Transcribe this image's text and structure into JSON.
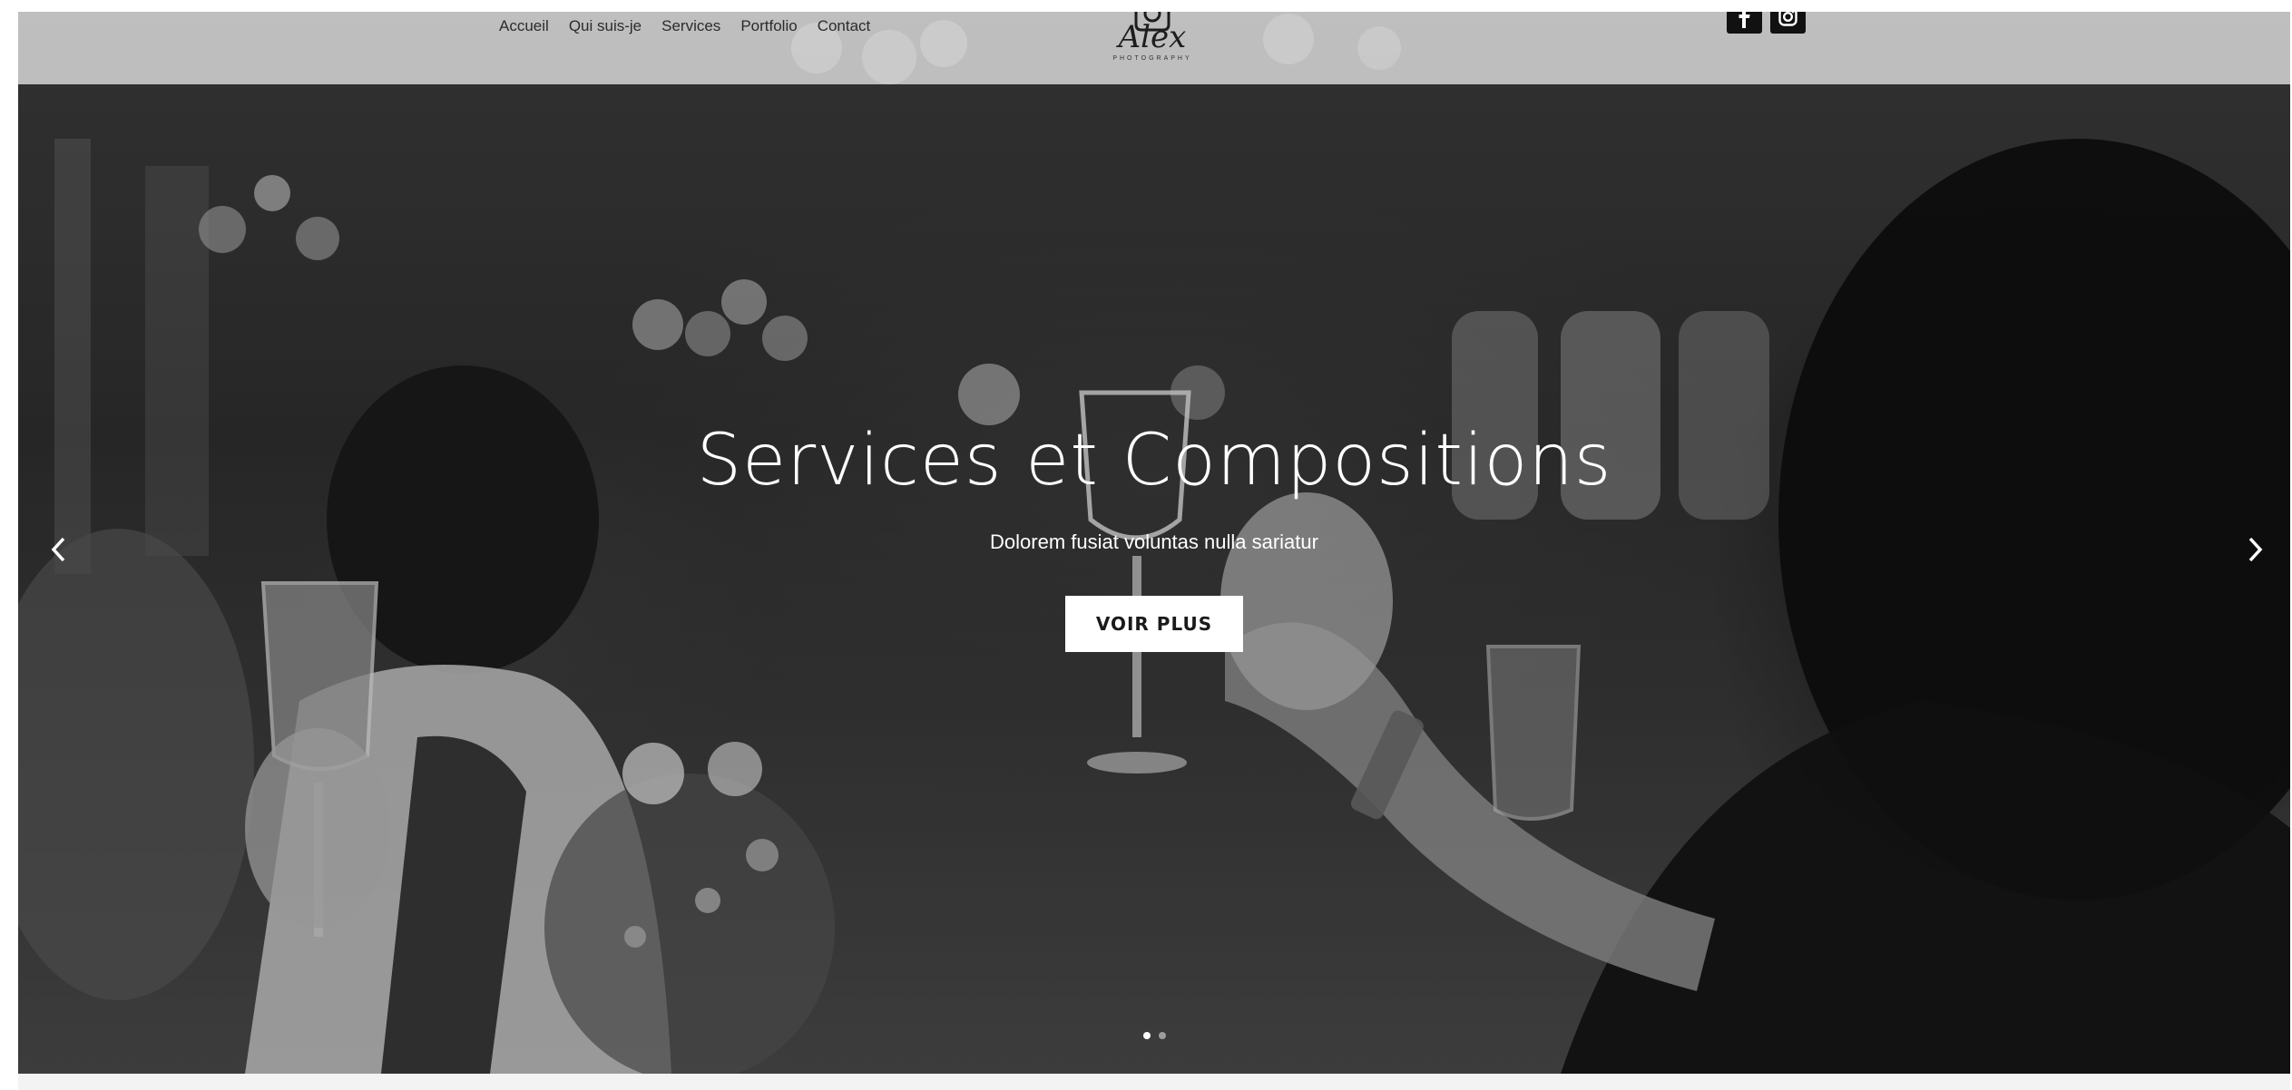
{
  "nav": {
    "items": [
      {
        "label": "Accueil"
      },
      {
        "label": "Qui suis-je"
      },
      {
        "label": "Services"
      },
      {
        "label": "Portfolio"
      },
      {
        "label": "Contact"
      }
    ]
  },
  "logo": {
    "word": "Alex",
    "subtitle": "PHOTOGRAPHY",
    "icon": "camera-icon"
  },
  "social": {
    "facebook_icon": "facebook-icon",
    "instagram_icon": "instagram-icon"
  },
  "hero": {
    "title": "Services et Compositions",
    "subtitle": "Dolorem fusiat voluntas nulla sariatur",
    "cta_label": "VOIR PLUS"
  },
  "slider": {
    "prev_icon": "chevron-left-icon",
    "next_icon": "chevron-right-icon",
    "slide_count": 2,
    "active_slide": 1
  },
  "colors": {
    "header_bg": "#dedede",
    "text_light": "#ffffff",
    "button_bg": "#ffffff",
    "social_bg": "#111111"
  }
}
